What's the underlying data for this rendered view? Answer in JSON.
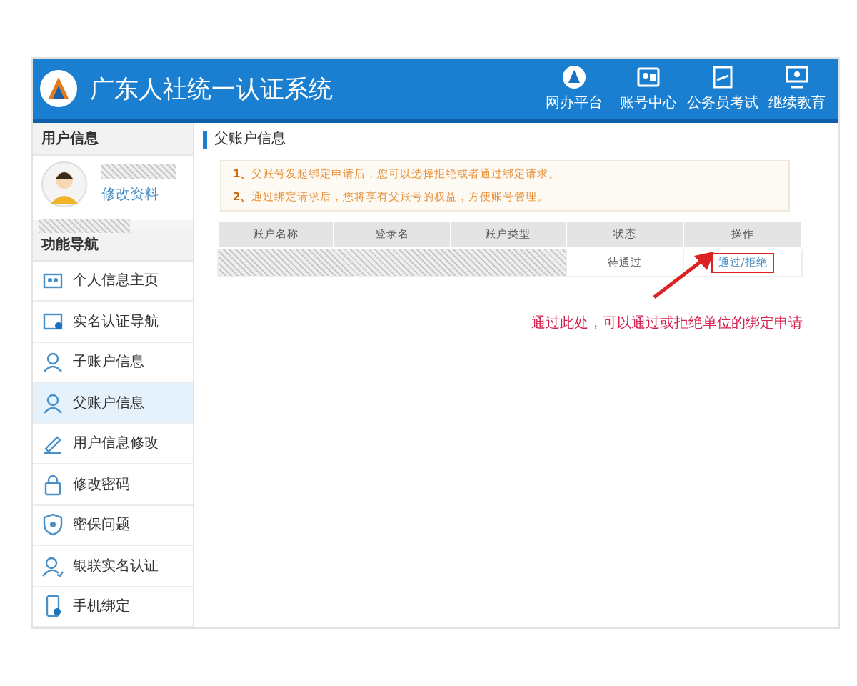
{
  "header": {
    "title": "广东人社统一认证系统",
    "nav": [
      {
        "label": "网办平台"
      },
      {
        "label": "账号中心"
      },
      {
        "label": "公务员考试"
      },
      {
        "label": "继续教育"
      }
    ]
  },
  "sidebar": {
    "user_section": {
      "title": "用户信息",
      "edit_link": "修改资料"
    },
    "nav_title": "功能导航",
    "items": [
      {
        "label": "个人信息主页",
        "selected": false
      },
      {
        "label": "实名认证导航",
        "selected": false
      },
      {
        "label": "子账户信息",
        "selected": false
      },
      {
        "label": "父账户信息",
        "selected": true
      },
      {
        "label": "用户信息修改",
        "selected": false
      },
      {
        "label": "修改密码",
        "selected": false
      },
      {
        "label": "密保问题",
        "selected": false
      },
      {
        "label": "银联实名认证",
        "selected": false
      },
      {
        "label": "手机绑定",
        "selected": false
      }
    ]
  },
  "main": {
    "title": "父账户信息",
    "notices": [
      {
        "number": "1、",
        "text": "父账号发起绑定申请后，您可以选择拒绝或者通过绑定请求。"
      },
      {
        "number": "2、",
        "text": "通过绑定请求后，您将享有父账号的权益，方便账号管理。"
      }
    ],
    "table": {
      "columns": [
        "账户名称",
        "登录名",
        "账户类型",
        "状态",
        "操作"
      ],
      "rows": [
        {
          "status": "待通过",
          "action": "通过/拒绝"
        }
      ]
    },
    "annotation": "通过此处，可以通过或拒绝单位的绑定申请"
  }
}
